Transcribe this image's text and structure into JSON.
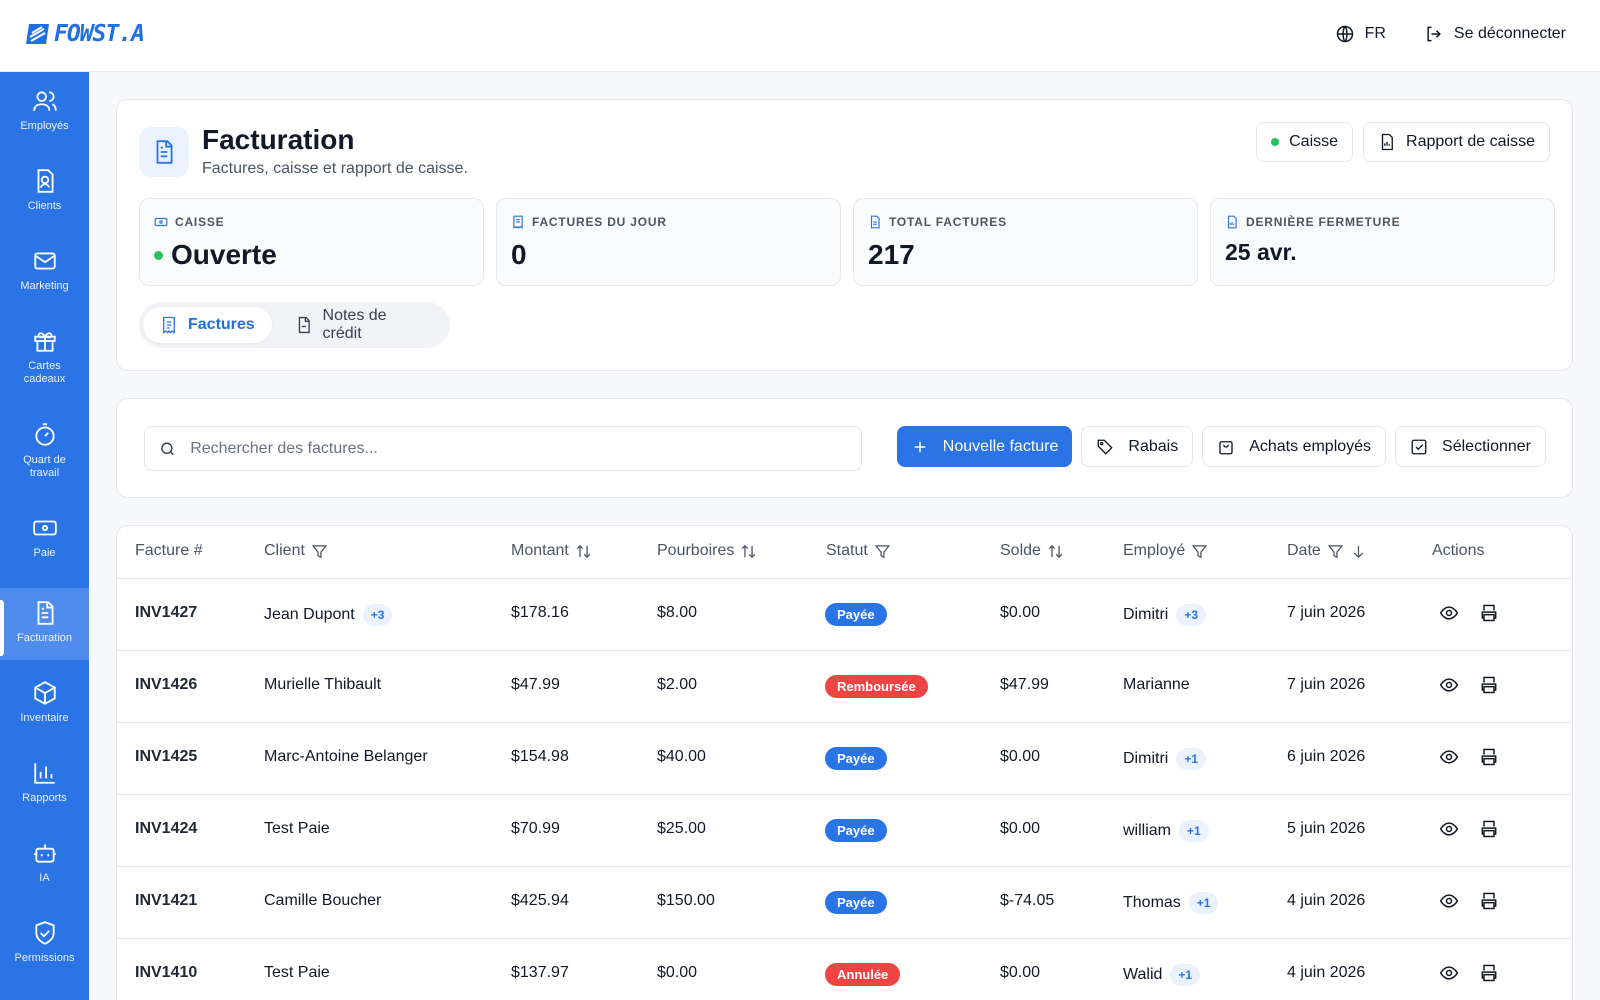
{
  "brand": {
    "logo_text": "FOWST.A",
    "accent": "#2a74e6"
  },
  "top": {
    "language": "FR",
    "logout": "Se déconnecter"
  },
  "sidebar": {
    "items": [
      {
        "label": "Employés",
        "icon": "users-icon"
      },
      {
        "label": "Clients",
        "icon": "contact-icon"
      },
      {
        "label": "Marketing",
        "icon": "mail-icon"
      },
      {
        "label": "Cartes cadeaux",
        "icon": "gift-icon"
      },
      {
        "label": "Quart de travail",
        "icon": "stopwatch-icon"
      },
      {
        "label": "Paie",
        "icon": "banknote-icon"
      },
      {
        "label": "Facturation",
        "icon": "file-text-icon"
      },
      {
        "label": "Inventaire",
        "icon": "box-icon"
      },
      {
        "label": "Rapports",
        "icon": "bar-chart-icon"
      },
      {
        "label": "IA",
        "icon": "robot-icon"
      },
      {
        "label": "Permissions",
        "icon": "shield-check-icon"
      }
    ],
    "active": "Facturation"
  },
  "header": {
    "title": "Facturation",
    "subtitle": "Factures, caisse et rapport de caisse.",
    "caisse_button": "Caisse",
    "report_button": "Rapport de caisse"
  },
  "stats": [
    {
      "label": "CAISSE",
      "value": "Ouverte"
    },
    {
      "label": "FACTURES DU JOUR",
      "value": "0"
    },
    {
      "label": "TOTAL FACTURES",
      "value": "217"
    },
    {
      "label": "DERNIÈRE FERMETURE",
      "value": "25 avr."
    }
  ],
  "tabs": [
    {
      "label": "Factures",
      "active": true
    },
    {
      "label": "Notes de crédit",
      "active": false
    }
  ],
  "toolbar": {
    "search_placeholder": "Rechercher des factures...",
    "new_invoice": "Nouvelle facture",
    "discounts": "Rabais",
    "employee_purchases": "Achats employés",
    "select": "Sélectionner"
  },
  "table": {
    "columns": [
      "Facture #",
      "Client",
      "Montant",
      "Pourboires",
      "Statut",
      "Solde",
      "Employé",
      "Date",
      "Actions"
    ],
    "rows": [
      {
        "invoice": "INV1427",
        "client": "Jean Dupont",
        "client_extra": "+3",
        "amount": "$178.16",
        "tips": "$8.00",
        "status": "Payée",
        "status_kind": "paid",
        "balance": "$0.00",
        "employee": "Dimitri",
        "employee_extra": "+3",
        "date": "7 juin 2026"
      },
      {
        "invoice": "INV1426",
        "client": "Murielle Thibault",
        "client_extra": "",
        "amount": "$47.99",
        "tips": "$2.00",
        "status": "Remboursée",
        "status_kind": "red",
        "balance": "$47.99",
        "employee": "Marianne",
        "employee_extra": "",
        "date": "7 juin 2026"
      },
      {
        "invoice": "INV1425",
        "client": "Marc-Antoine Belanger",
        "client_extra": "",
        "amount": "$154.98",
        "tips": "$40.00",
        "status": "Payée",
        "status_kind": "paid",
        "balance": "$0.00",
        "employee": "Dimitri",
        "employee_extra": "+1",
        "date": "6 juin 2026"
      },
      {
        "invoice": "INV1424",
        "client": "Test Paie",
        "client_extra": "",
        "amount": "$70.99",
        "tips": "$25.00",
        "status": "Payée",
        "status_kind": "paid",
        "balance": "$0.00",
        "employee": "william",
        "employee_extra": "+1",
        "date": "5 juin 2026"
      },
      {
        "invoice": "INV1421",
        "client": "Camille Boucher",
        "client_extra": "",
        "amount": "$425.94",
        "tips": "$150.00",
        "status": "Payée",
        "status_kind": "paid",
        "balance": "$-74.05",
        "employee": "Thomas",
        "employee_extra": "+1",
        "date": "4 juin 2026"
      },
      {
        "invoice": "INV1410",
        "client": "Test Paie",
        "client_extra": "",
        "amount": "$137.97",
        "tips": "$0.00",
        "status": "Annulée",
        "status_kind": "red",
        "balance": "$0.00",
        "employee": "Walid",
        "employee_extra": "+1",
        "date": "4 juin 2026"
      }
    ]
  }
}
